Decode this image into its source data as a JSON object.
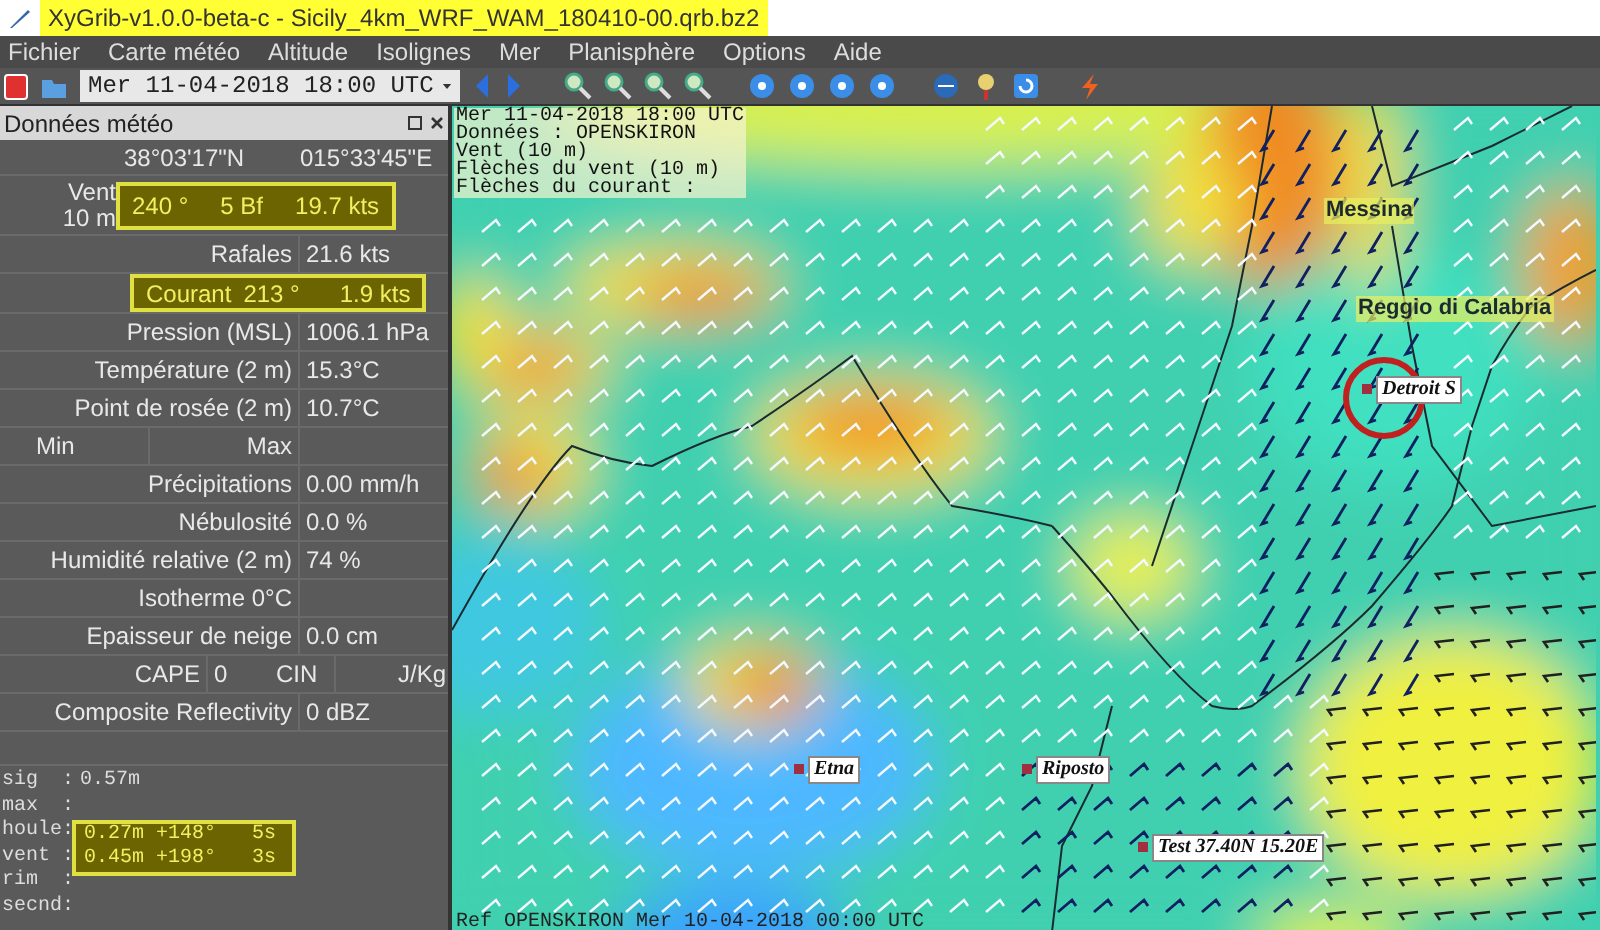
{
  "window": {
    "title": "XyGrib-v1.0.0-beta-c - Sicily_4km_WRF_WAM_180410-00.qrb.bz2"
  },
  "menu": [
    "Fichier",
    "Carte météo",
    "Altitude",
    "Isolignes",
    "Mer",
    "Planisphère",
    "Options",
    "Aide"
  ],
  "toolbar": {
    "date": "Mer 11-04-2018 18:00 UTC"
  },
  "panel": {
    "title": "Données météo",
    "rows": [
      {
        "kind": "coords",
        "lat": "38°03'17\"N",
        "lon": "015°33'45\"E"
      },
      {
        "kind": "wind",
        "label": "Vent",
        "sublabel": "10 m",
        "values": [
          "240 °",
          "5 Bf",
          "19.7 kts"
        ],
        "highlighted": true
      },
      {
        "kind": "field",
        "label": "Rafales",
        "value": "21.6 kts"
      },
      {
        "kind": "current",
        "label": "Courant",
        "values": [
          "213 °",
          "1.9 kts"
        ],
        "highlighted": true
      },
      {
        "kind": "field",
        "label": "Pression (MSL)",
        "value": "1006.1 hPa"
      },
      {
        "kind": "field",
        "label": "Température (2 m)",
        "value": "15.3°C"
      },
      {
        "kind": "field",
        "label": "Point de rosée (2 m)",
        "value": "10.7°C"
      },
      {
        "kind": "minmax",
        "labels": [
          "Min",
          "Max"
        ]
      },
      {
        "kind": "field",
        "label": "Précipitations",
        "value": "0.00 mm/h"
      },
      {
        "kind": "field",
        "label": "Nébulosité",
        "value": "0.0 %"
      },
      {
        "kind": "field",
        "label": "Humidité relative (2 m)",
        "value": "74 %"
      },
      {
        "kind": "field",
        "label": "Isotherme 0°C"
      },
      {
        "kind": "field",
        "label": "Epaisseur de neige",
        "value": "0.0 cm"
      },
      {
        "kind": "cape",
        "label": "CAPE",
        "value": "0",
        "label2": "CIN",
        "unit": "J/Kg"
      },
      {
        "kind": "field",
        "label": "Composite Reflectivity",
        "value": "0 dBZ"
      }
    ],
    "waves": [
      {
        "label": "sig  :",
        "value": "0.57m",
        "highlighted": false
      },
      {
        "label": "max  :",
        "highlighted": false
      },
      {
        "label": "houle:",
        "value": "0.27m +148°   5s",
        "highlighted": true
      },
      {
        "label": "vent :",
        "value": "0.45m +198°   3s",
        "highlighted": true
      },
      {
        "label": "rim  :",
        "highlighted": false
      },
      {
        "label": "secnd:",
        "highlighted": false
      }
    ]
  },
  "map": {
    "legend": [
      "Mer 11-04-2018 18:00 UTC",
      "Données : OPENSKIRON",
      "Vent (10 m)",
      "Flèches du vent (10 m)",
      "Flèches du courant :"
    ],
    "places": [
      {
        "name": "Messina",
        "kind": "city"
      },
      {
        "name": "Reggio di Calabria",
        "kind": "city"
      },
      {
        "name": "Detroit S",
        "kind": "marker"
      },
      {
        "name": "Etna",
        "kind": "marker"
      },
      {
        "name": "Riposto",
        "kind": "marker"
      },
      {
        "name": "Test 37.40N 15.20E",
        "kind": "marker"
      }
    ],
    "footer": "Ref OPENSKIRON  Mer 10-04-2018 00:00 UTC"
  }
}
